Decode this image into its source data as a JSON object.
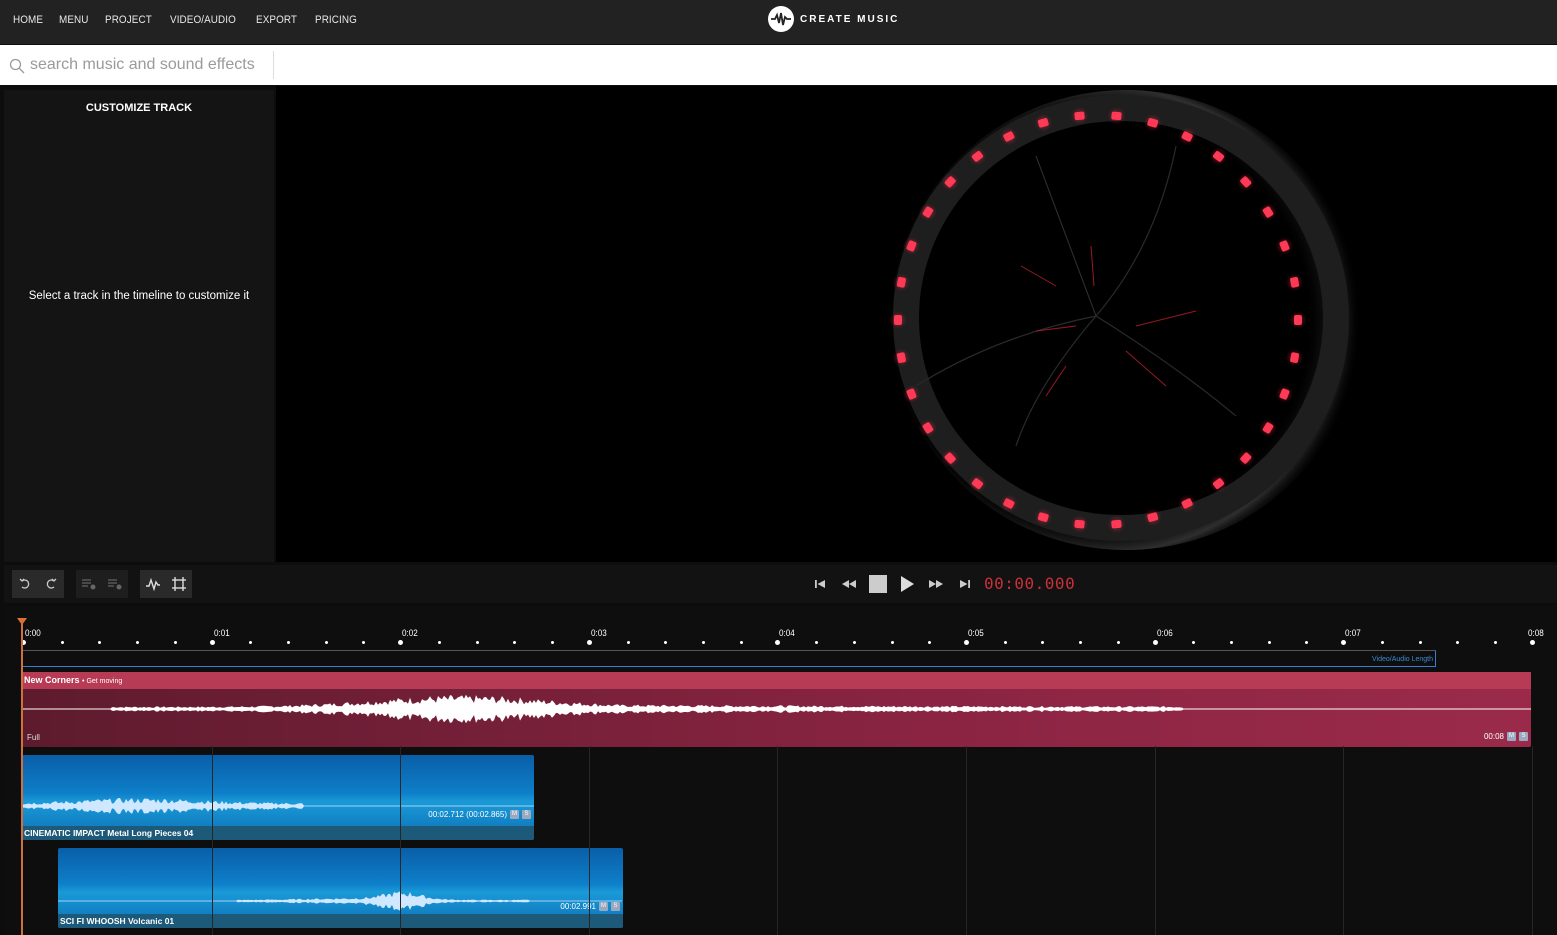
{
  "nav": {
    "items": [
      "HOME",
      "MENU",
      "PROJECT",
      "VIDEO/AUDIO",
      "EXPORT",
      "PRICING"
    ]
  },
  "logo": {
    "text": "CREATE MUSIC"
  },
  "search": {
    "placeholder": "search music and sound effects",
    "value": ""
  },
  "customize": {
    "title": "CUSTOMIZE TRACK",
    "message": "Select a track in the timeline to customize it"
  },
  "player": {
    "time": "00:00.000"
  },
  "timeline": {
    "ticks": [
      "0:00",
      "0:01",
      "0:02",
      "0:03",
      "0:04",
      "0:05",
      "0:06",
      "0:07",
      "0:08"
    ],
    "video_length_label": "Video/Audio Length",
    "music_track": {
      "name": "New Corners",
      "subtitle": "• Get moving",
      "variant": "Full",
      "duration": "00:08",
      "mute_label": "M",
      "solo_label": "S"
    },
    "sfx_tracks": [
      {
        "name": "CINEMATIC IMPACT Metal Long Pieces 04",
        "duration": "00:02.712 (00:02.865)",
        "mute_label": "M",
        "solo_label": "S"
      },
      {
        "name": "SCI FI WHOOSH Volcanic 01",
        "duration": "00:02.991",
        "mute_label": "M",
        "solo_label": "S"
      }
    ]
  },
  "colors": {
    "topbar": "#222222",
    "music_track": "#8a2442",
    "music_header": "#b73b54",
    "sfx_track": "#0e7fc9",
    "timecode": "#c8303a",
    "playhead": "#e07030"
  }
}
